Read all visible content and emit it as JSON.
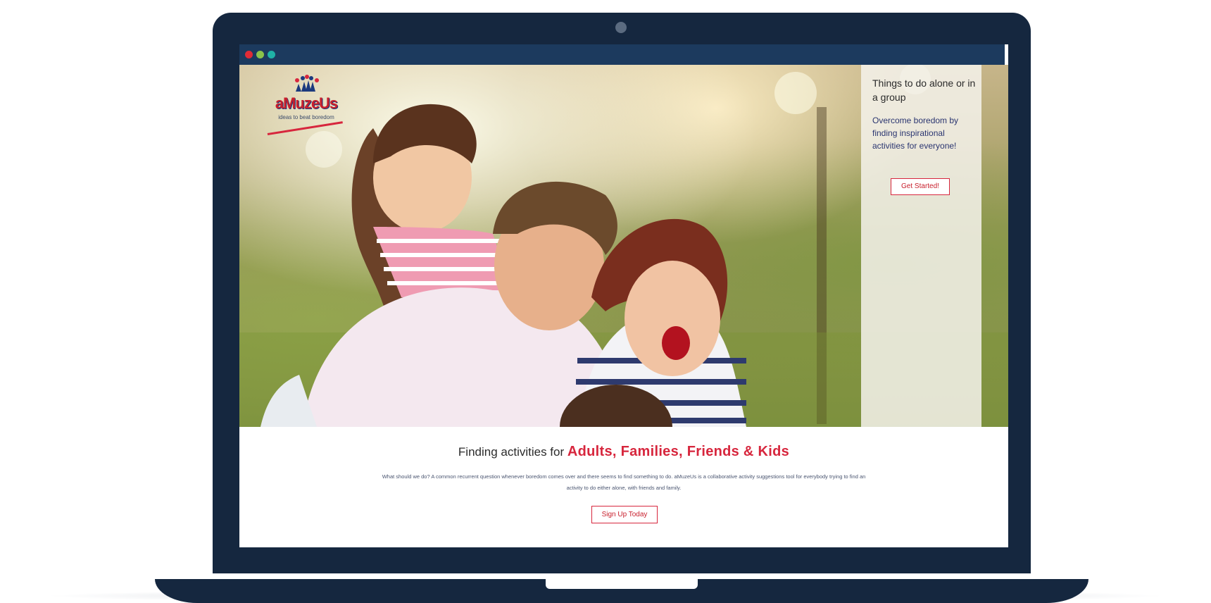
{
  "browser": {
    "window_dots": [
      {
        "color": "#e02b36"
      },
      {
        "color": "#8bc34a"
      },
      {
        "color": "#1fb2a6"
      }
    ]
  },
  "logo": {
    "text": "aMuzeUs",
    "tagline": "ideas to beat boredom"
  },
  "side_panel": {
    "title": "Things to do alone or in a group",
    "description": "Overcome boredom by finding inspirational activities for everyone!",
    "button_label": "Get Started!"
  },
  "headline": {
    "prefix": "Finding activities for ",
    "accent": "Adults, Families, Friends & Kids",
    "accent_color": "#d7263d"
  },
  "body_text": "What should we do? A common recurrent question whenever boredom comes over and there seems to find something to do. aMuzeUs is a collaborative activity suggestions tool for everybody trying to find an activity to do either alone, with friends and family.",
  "cta": {
    "label": "Sign Up Today"
  },
  "colors": {
    "frame": "#15273f",
    "browser_bar": "#1c3a5e",
    "brand_red": "#d7263d"
  }
}
